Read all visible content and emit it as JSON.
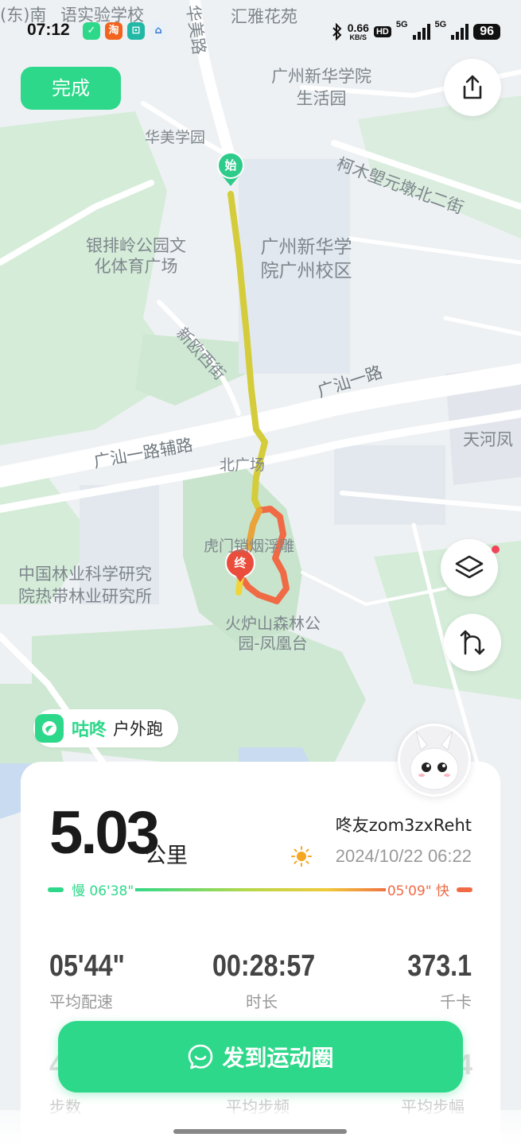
{
  "status_bar": {
    "time": "07:12",
    "net_speed": "0.66",
    "net_unit": "KB/S",
    "hd_label": "HD",
    "signal_1": "5G",
    "signal_2": "5G",
    "battery": "96",
    "app_icons": [
      "gudong-icon",
      "taobao-icon",
      "mijia-icon",
      "home-icon"
    ]
  },
  "header": {
    "done_label": "完成"
  },
  "map": {
    "labels": [
      "(东)南",
      "语实验学校",
      "华美路",
      "汇雅花苑",
      "广州新华学院生活园",
      "华美学园",
      "柯木塱元墩北二街",
      "银排岭公园文化体育广场",
      "广州新华学院广州校区",
      "新欧西街",
      "广汕一路",
      "天河凤",
      "广汕一路辅路",
      "北广场",
      "虎门销烟浮雕",
      "中国林业科学研究院热带林业研究所",
      "火炉山森林公园-凤凰台"
    ],
    "start_marker": "始",
    "end_marker": "终"
  },
  "brand": {
    "name": "咕咚",
    "activity": "户外跑",
    "accent": "#2ed88a"
  },
  "summary": {
    "distance": "5.03",
    "distance_unit": "公里",
    "username": "咚友zom3zxReht",
    "datetime": "2024/10/22 06:22",
    "pace_slow": "慢 06'38\"",
    "pace_fast": "05'09\" 快"
  },
  "stats": [
    {
      "value": "05'44\"",
      "label": "平均配速"
    },
    {
      "value": "00:28:57",
      "label": "时长"
    },
    {
      "value": "373.1",
      "label": "千卡"
    }
  ],
  "stats_row2": [
    {
      "value": "4",
      "label": "步数"
    },
    {
      "value": "",
      "label": "平均步频"
    },
    {
      "value": "4",
      "label": "平均步幅"
    }
  ],
  "post_button": {
    "label": "发到运动圈"
  },
  "colors": {
    "route_slow": "#d4cc3a",
    "route_fast": "#ef6a45",
    "accent": "#2ed88a"
  }
}
